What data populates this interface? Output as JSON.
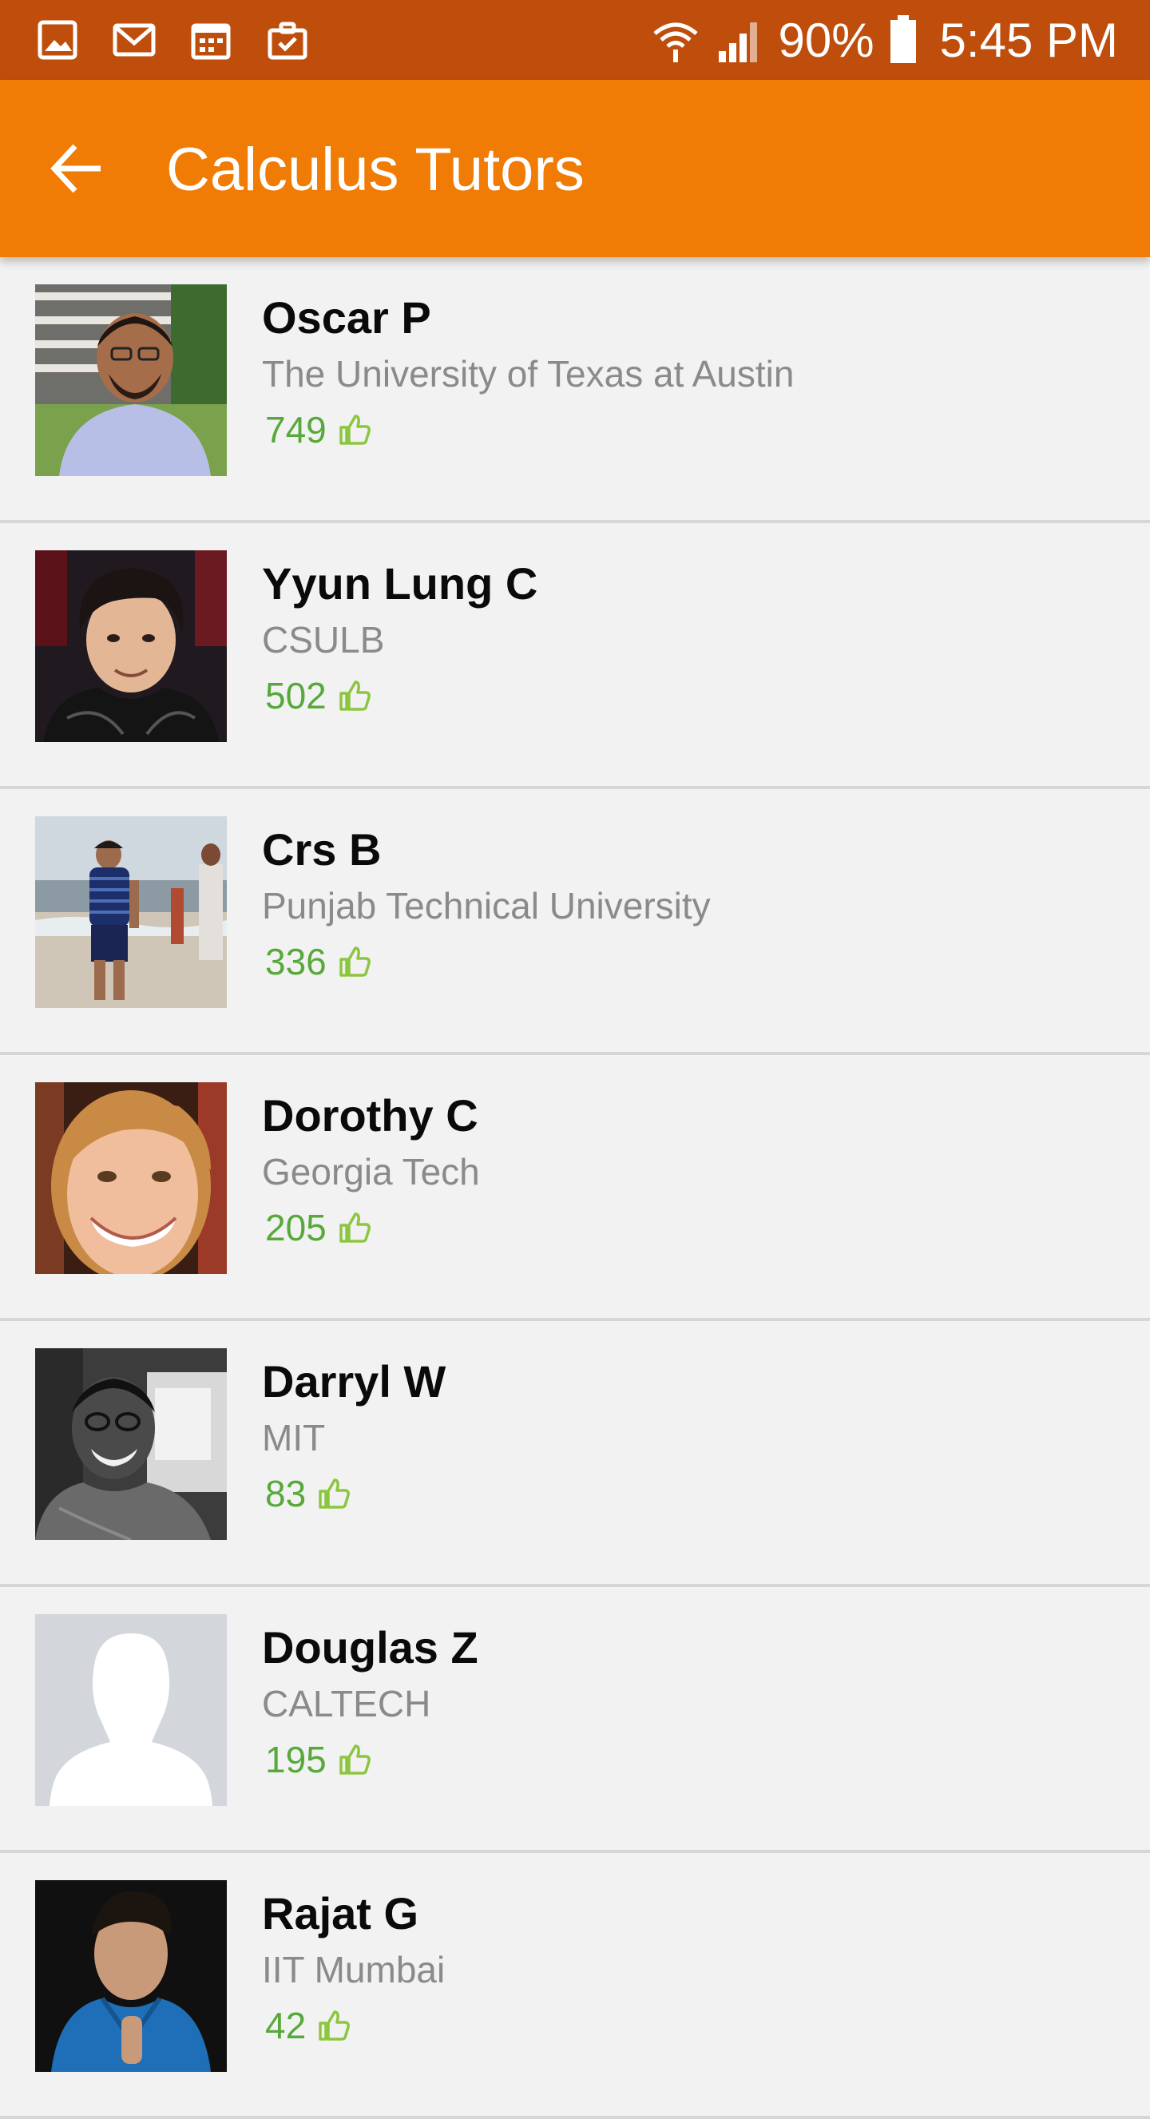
{
  "status_bar": {
    "battery": "90%",
    "time": "5:45 PM",
    "icons": [
      "gallery-icon",
      "gmail-icon",
      "calendar-icon",
      "briefcase-icon",
      "wifi-icon",
      "signal-icon",
      "battery-icon"
    ]
  },
  "app_bar": {
    "title": "Calculus Tutors",
    "back_icon": "arrow-back-icon"
  },
  "colors": {
    "status_bar": "#bf4e0c",
    "app_bar": "#f07b05",
    "likes": "#56a93a",
    "background": "#f2f2f2"
  },
  "tutors": [
    {
      "name": "Oscar P",
      "school": "The University of Texas at Austin",
      "likes": "749",
      "avatar": "photo"
    },
    {
      "name": "Yyun Lung C",
      "school": "CSULB",
      "likes": "502",
      "avatar": "photo"
    },
    {
      "name": "Crs B",
      "school": "Punjab Technical University",
      "likes": "336",
      "avatar": "photo"
    },
    {
      "name": "Dorothy C",
      "school": "Georgia Tech",
      "likes": "205",
      "avatar": "photo"
    },
    {
      "name": "Darryl W",
      "school": "MIT",
      "likes": "83",
      "avatar": "photo"
    },
    {
      "name": "Douglas Z",
      "school": "CALTECH",
      "likes": "195",
      "avatar": "placeholder-silhouette"
    },
    {
      "name": "Rajat G",
      "school": "IIT Mumbai",
      "likes": "42",
      "avatar": "photo"
    }
  ]
}
